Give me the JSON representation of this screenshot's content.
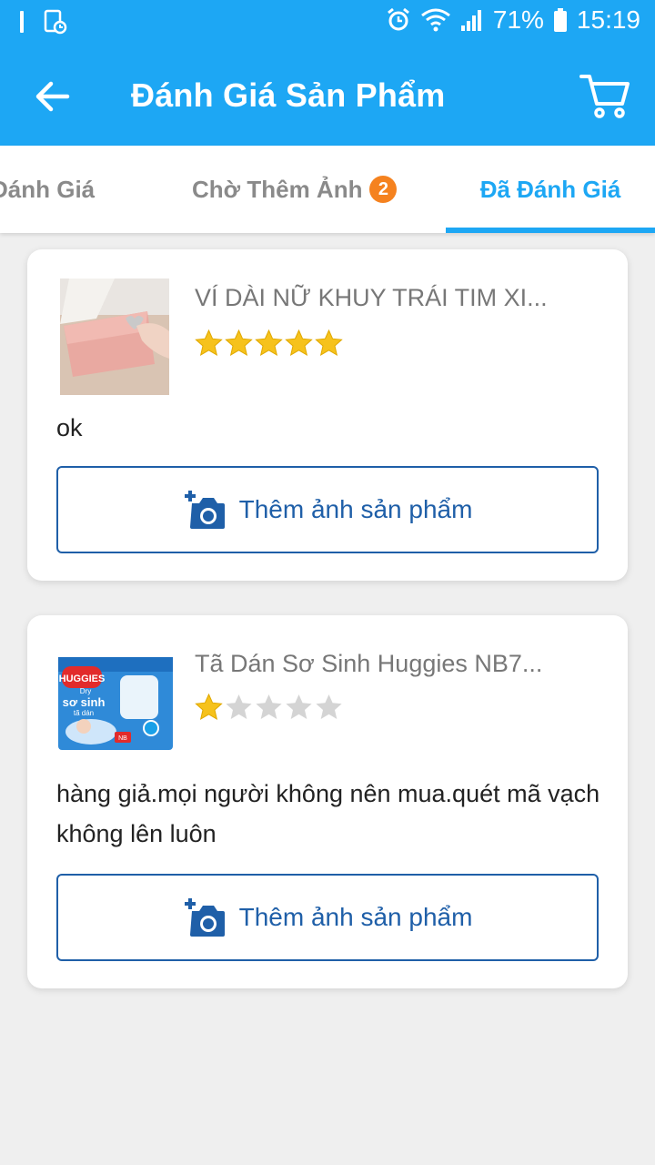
{
  "status_bar": {
    "battery": "71%",
    "time": "15:19"
  },
  "header": {
    "title": "Đánh Giá Sản Phẩm"
  },
  "tabs": [
    {
      "label": "Đánh Giá"
    },
    {
      "label": "Chờ Thêm Ảnh",
      "badge": "2"
    },
    {
      "label": "Đã Đánh Giá",
      "active": true
    }
  ],
  "reviews": [
    {
      "product_name": "VÍ DÀI NỮ KHUY TRÁI TIM XI...",
      "rating": 5,
      "comment": "ok",
      "add_photo_label": "Thêm ảnh sản phẩm"
    },
    {
      "product_name": "Tã Dán Sơ Sinh Huggies NB7...",
      "rating": 1,
      "comment": "hàng giả.mọi người không nên mua.quét mã vạch không lên luôn",
      "add_photo_label": "Thêm ảnh sản phẩm",
      "thumb_text": {
        "brand": "HUGGIES",
        "line": "Dry",
        "subtitle1": "sơ sinh",
        "subtitle2": "tã dán",
        "size": "NB"
      }
    }
  ],
  "colors": {
    "primary": "#1da7f4",
    "badge": "#f5821f",
    "button_border": "#1f5fa8",
    "star_on": "#f6c21c",
    "star_off": "#d4d4d4"
  }
}
